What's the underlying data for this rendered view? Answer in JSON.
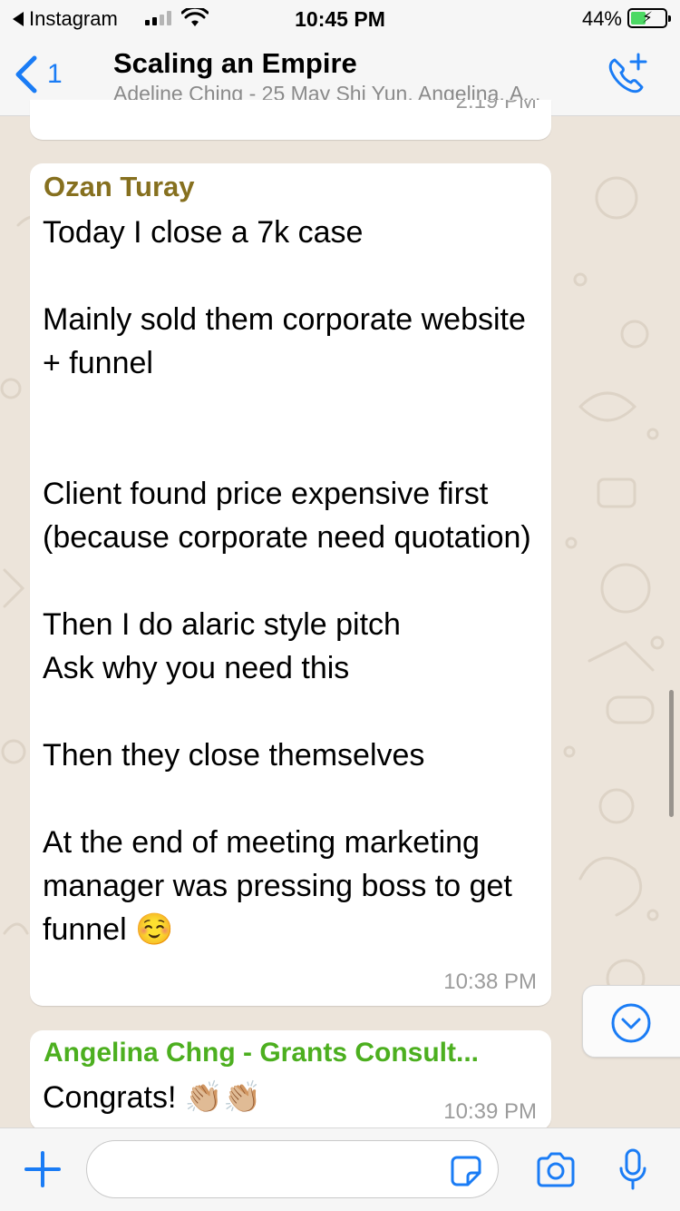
{
  "status_bar": {
    "back_app": "Instagram",
    "time": "10:45 PM",
    "battery_percent": "44%",
    "battery_level": 0.44
  },
  "header": {
    "back_count": "1",
    "title": "Scaling an Empire",
    "subtitle": "Adeline Ching - 25 May Shi Yun, Angelina, A..."
  },
  "messages": [
    {
      "time": "2:19 PM",
      "partial": true
    },
    {
      "sender": "Ozan Turay",
      "sender_color": "#86701f",
      "lines": "Today I close a 7k case\n\nMainly sold them corporate website + funnel\n\n\nClient found price expensive first (because corporate need quotation)\n\nThen I do alaric style pitch\nAsk why you need this\n\nThen they close themselves\n\nAt the end of meeting marketing manager was pressing boss to get funnel",
      "emoji": "☺️",
      "time": "10:38 PM"
    },
    {
      "sender": "Angelina Chng - Grants Consult...",
      "sender_color": "#4caf1f",
      "text": "Congrats!",
      "emoji": "👏🏼👏🏼",
      "time": "10:39 PM"
    }
  ],
  "input": {
    "placeholder": ""
  },
  "colors": {
    "accent": "#1a7cf5",
    "bar_background": "#f6f6f6",
    "wallpaper": "#ece4da"
  },
  "icons": {
    "back": "chevron-left-icon",
    "call": "add-call-icon",
    "scroll": "chevron-down-circle-icon",
    "attach": "plus-icon",
    "sticker": "sticker-icon",
    "camera": "camera-icon",
    "mic": "microphone-icon"
  }
}
